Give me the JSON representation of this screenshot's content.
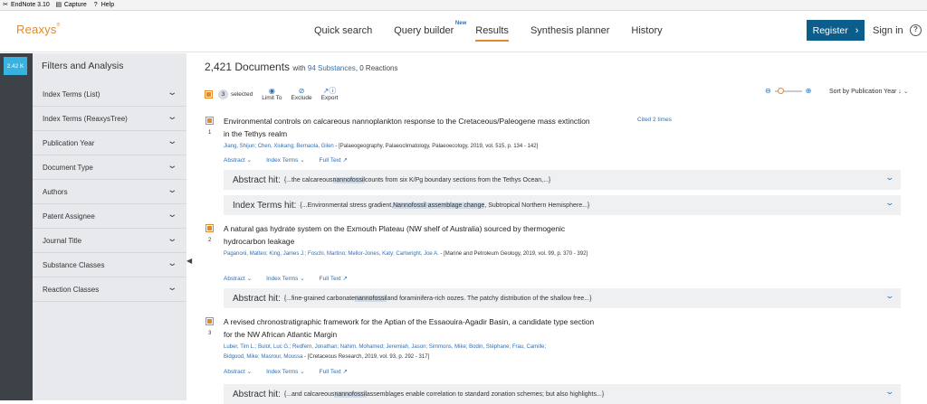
{
  "toolbar": {
    "items": [
      {
        "icon": "endnote-icon",
        "label": "EndNote 3.10"
      },
      {
        "icon": "capture-icon",
        "label": "Capture"
      },
      {
        "icon": "help-icon",
        "label": "Help"
      }
    ]
  },
  "header": {
    "logo": "Reaxys",
    "nav": [
      {
        "label": "Quick search"
      },
      {
        "label": "Query builder",
        "badge": "New"
      },
      {
        "label": "Results",
        "active": true
      },
      {
        "label": "Synthesis planner"
      },
      {
        "label": "History"
      }
    ],
    "register_label": "Register",
    "signin_label": "Sign in",
    "help_label": "?"
  },
  "sidebar": {
    "count_badge": "2.42 K",
    "title": "Filters and Analysis",
    "filters": [
      {
        "label": "Index Terms (List)"
      },
      {
        "label": "Index Terms (ReaxysTree)"
      },
      {
        "label": "Publication Year"
      },
      {
        "label": "Document Type"
      },
      {
        "label": "Authors"
      },
      {
        "label": "Patent Assignee"
      },
      {
        "label": "Journal Title"
      },
      {
        "label": "Substance Classes"
      },
      {
        "label": "Reaction Classes"
      }
    ]
  },
  "results_header": {
    "count": "2,421 Documents",
    "with_text": "with",
    "substances_link": "94 Substances",
    "reactions_text": ", 0 Reactions",
    "selected_count": "3",
    "selected_label": "selected",
    "actions": [
      {
        "icon": "eye-icon",
        "label": "Limit To"
      },
      {
        "icon": "exclude-icon",
        "label": "Exclude"
      },
      {
        "icon": "export-icon",
        "label": "Export"
      }
    ],
    "sort_label": "Sort by Publication Year ↓"
  },
  "results": [
    {
      "num": "1",
      "title": "Environmental controls on calcareous nannoplankton response to the Cretaceous/Paleogene mass extinction in the Tethys realm",
      "cited": "Cited 2 times",
      "authors": [
        "Jiang, Shijun; Chen, Xiukang; Bernaola, Gilen"
      ],
      "source": " - [Palaeogeography, Palaeoclimatology, Palaeoecology, 2019, vol. 515, p. 134 - 142]",
      "links": [
        "Abstract ⌄",
        "Index Terms ⌄",
        "Full Text ↗"
      ],
      "hits": [
        {
          "label": "Abstract hit:",
          "pre": "{...the calcareous ",
          "hl": "nannofossil",
          "post": " counts from six K/Pg boundary sections from the Tethys Ocean,...}"
        },
        {
          "label": "Index Terms hit:",
          "pre": "{...Environmental stress gradient, ",
          "hl": "Nannofossil assemblage change",
          "post": ", Subtropical Northern Hemisphere...}"
        }
      ]
    },
    {
      "num": "2",
      "title": "A natural gas hydrate system on the Exmouth Plateau (NW shelf of Australia) sourced by thermogenic hydrocarbon leakage",
      "cited": "",
      "authors": [
        "Paganoni, Matteo; King, James J.; Foschi, Martino; Mellor-Jones, Katy; Cartwright, Joe A."
      ],
      "source": " - [Marine and Petroleum Geology, 2019, vol. 99, p. 370 - 392]",
      "links": [
        "Abstract ⌄",
        "Index Terms ⌄",
        "Full Text ↗"
      ],
      "hits": [
        {
          "label": "Abstract hit:",
          "pre": "{...fine-grained carbonate ",
          "hl": "nannofossil",
          "post": " and foraminifera-rich oozes. The patchy distribution of the shallow free...}"
        }
      ]
    },
    {
      "num": "3",
      "title": "A revised chronostratigraphic framework for the Aptian of the Essaouira-Agadir Basin, a candidate type section for the NW African Atlantic Margin",
      "cited": "",
      "authors": [
        "Luber, Tim L.; Bulot, Luc G.; Redfern, Jonathan; Nahim, Mohamed; Jeremiah, Jason; Simmons, Mike; Bodin, Stéphane; Frau, Camille;",
        "Bidgood, Mike; Masrour, Moussa"
      ],
      "source": " - [Cretaceous Research, 2019, vol. 93, p. 292 - 317]",
      "links": [
        "Abstract ⌄",
        "Index Terms ⌄",
        "Full Text ↗"
      ],
      "hits": [
        {
          "label": "Abstract hit:",
          "pre": "{...and calcareous ",
          "hl": "nannofossil",
          "post": " assemblages enable correlation to standard zonation schemes; but also highlights...}"
        }
      ]
    }
  ]
}
